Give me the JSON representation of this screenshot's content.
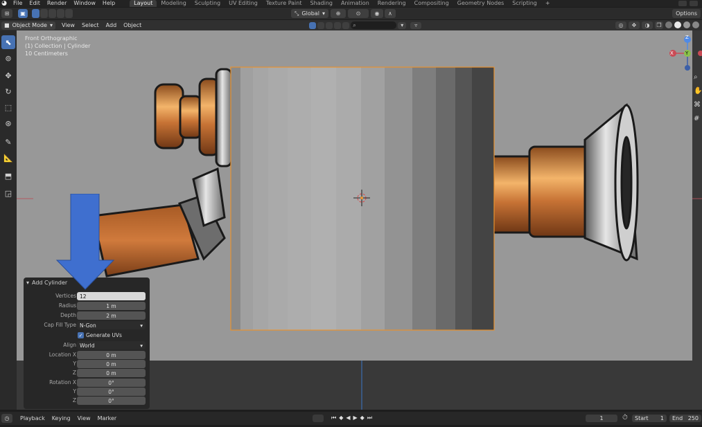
{
  "topbar": {
    "menus": [
      "File",
      "Edit",
      "Render",
      "Window",
      "Help"
    ],
    "workspaces": [
      "Layout",
      "Modeling",
      "Sculpting",
      "UV Editing",
      "Texture Paint",
      "Shading",
      "Animation",
      "Rendering",
      "Compositing",
      "Geometry Nodes",
      "Scripting"
    ],
    "active_workspace": "Layout"
  },
  "header1": {
    "orientation": "Global",
    "options_label": "Options"
  },
  "header2": {
    "mode": "Object Mode",
    "menus": [
      "View",
      "Select",
      "Add",
      "Object"
    ]
  },
  "viewport": {
    "view_name": "Front Orthographic",
    "collection": "(1) Collection | Cylinder",
    "scale": "10 Centimeters",
    "gizmo_axes": {
      "x": "X",
      "y": "Y",
      "z": "Z"
    }
  },
  "operator_panel": {
    "title": "Add Cylinder",
    "vertices_label": "Vertices",
    "vertices": "12",
    "radius_label": "Radius",
    "radius": "1 m",
    "depth_label": "Depth",
    "depth": "2 m",
    "cap_fill_label": "Cap Fill Type",
    "cap_fill": "N-Gon",
    "generate_uvs": "Generate UVs",
    "align_label": "Align",
    "align": "World",
    "location_x_label": "Location X",
    "location_x": "0 m",
    "location_y_label": "Y",
    "location_y": "0 m",
    "location_z_label": "Z",
    "location_z": "0 m",
    "rotation_x_label": "Rotation X",
    "rotation_x": "0°",
    "rotation_y_label": "Y",
    "rotation_y": "0°",
    "rotation_z_label": "Z",
    "rotation_z": "0°"
  },
  "timeline": {
    "menus": [
      "Playback",
      "Keying",
      "View",
      "Marker"
    ],
    "current_frame": "1",
    "start_label": "Start",
    "start": "1",
    "end_label": "End",
    "end": "250"
  },
  "colors": {
    "accent": "#4772b3",
    "selection_outline": "#e8922f",
    "arrow": "#3f6fcf"
  },
  "icons": [
    "blender-logo-icon",
    "cursor-icon",
    "move-icon",
    "rotate-icon",
    "scale-icon",
    "transform-icon",
    "annotate-icon",
    "measure-icon",
    "add-cube-icon",
    "play-icon",
    "zoom-icon",
    "hand-icon",
    "camera-icon",
    "grid-icon"
  ]
}
